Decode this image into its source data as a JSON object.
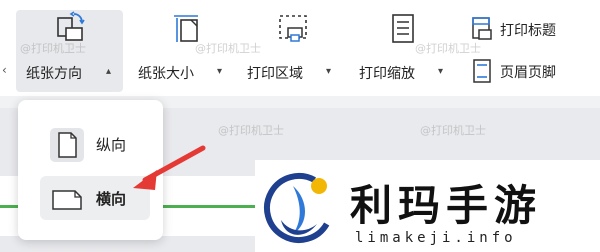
{
  "toolbar": {
    "left_caret": "‹",
    "paper_orientation": {
      "label": "纸张方向",
      "caret": "▴"
    },
    "paper_size": {
      "label": "纸张大小",
      "caret": "▾"
    },
    "print_area": {
      "label": "打印区域",
      "caret": "▾"
    },
    "print_scale": {
      "label": "打印缩放",
      "caret": "▾"
    },
    "print_titles": {
      "label": "打印标题"
    },
    "header_footer": {
      "label": "页眉页脚"
    }
  },
  "dropdown": {
    "items": [
      {
        "label": "纵向",
        "icon": "portrait-page-icon"
      },
      {
        "label": "横向",
        "icon": "landscape-page-icon"
      }
    ],
    "highlighted": "横向"
  },
  "watermark_text": "@打印机卫士",
  "logo": {
    "cn": "利玛手游",
    "en": "limakeji.info"
  },
  "colors": {
    "accent_blue": "#2f79d8",
    "arrow_red": "#e53935",
    "green_rule": "#4caf50"
  }
}
